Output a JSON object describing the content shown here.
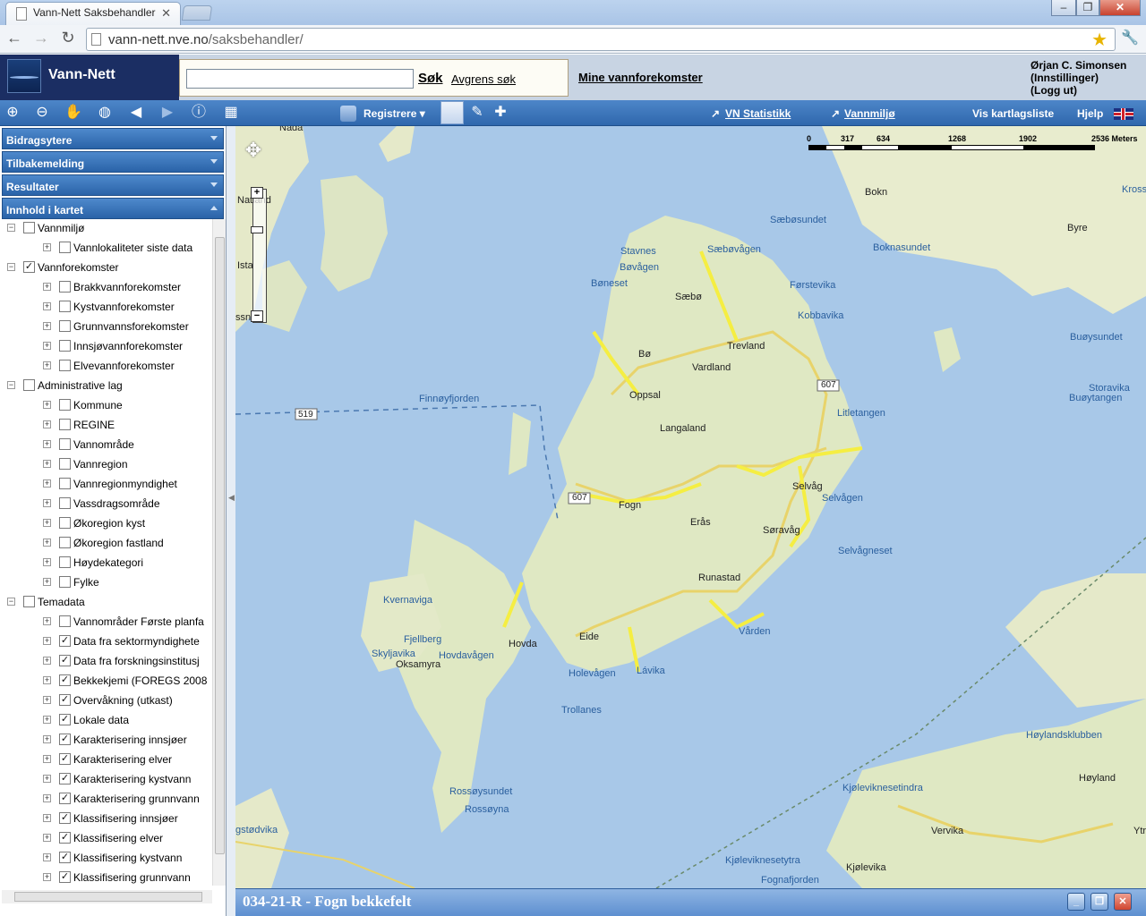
{
  "browser": {
    "tab_title": "Vann-Nett Saksbehandler",
    "url_host": "vann-nett.nve.no",
    "url_path": "/saksbehandler/"
  },
  "header": {
    "app_name": "Vann-Nett",
    "search_value": "",
    "search_button": "Søk",
    "refine_link": "Avgrens søk",
    "my_waterbodies": "Mine vannforekomster",
    "user_name": "Ørjan C. Simonsen",
    "settings_link": "(Innstillinger)",
    "logout_link": "(Logg ut)"
  },
  "toolbar": {
    "register_label": "Registrere",
    "statistics_link": "VN Statistikk",
    "vannmiljo_link": "Vannmiljø",
    "layer_list": "Vis kartlagsliste",
    "help": "Hjelp"
  },
  "sidebar": {
    "panels": [
      "Bidragsytere",
      "Tilbakemelding",
      "Resultater",
      "Innhold i kartet"
    ],
    "tree": [
      {
        "label": "Vannmiljø",
        "level": 0,
        "checked": false,
        "expanded": true
      },
      {
        "label": "Vannlokaliteter siste data",
        "level": 1,
        "checked": false
      },
      {
        "label": "Vannforekomster",
        "level": 0,
        "checked": true,
        "expanded": true
      },
      {
        "label": "Brakkvannforekomster",
        "level": 1,
        "checked": false
      },
      {
        "label": "Kystvannforekomster",
        "level": 1,
        "checked": false
      },
      {
        "label": "Grunnvannsforekomster",
        "level": 1,
        "checked": false
      },
      {
        "label": "Innsjøvannforekomster",
        "level": 1,
        "checked": false
      },
      {
        "label": "Elvevannforekomster",
        "level": 1,
        "checked": false
      },
      {
        "label": "Administrative lag",
        "level": 0,
        "checked": false,
        "expanded": true
      },
      {
        "label": "Kommune",
        "level": 1,
        "checked": false
      },
      {
        "label": "REGINE",
        "level": 1,
        "checked": false
      },
      {
        "label": "Vannområde",
        "level": 1,
        "checked": false
      },
      {
        "label": "Vannregion",
        "level": 1,
        "checked": false
      },
      {
        "label": "Vannregionmyndighet",
        "level": 1,
        "checked": false
      },
      {
        "label": "Vassdragsområde",
        "level": 1,
        "checked": false
      },
      {
        "label": "Økoregion kyst",
        "level": 1,
        "checked": false
      },
      {
        "label": "Økoregion fastland",
        "level": 1,
        "checked": false
      },
      {
        "label": "Høydekategori",
        "level": 1,
        "checked": false
      },
      {
        "label": "Fylke",
        "level": 1,
        "checked": false
      },
      {
        "label": "Temadata",
        "level": 0,
        "checked": false,
        "expanded": true
      },
      {
        "label": "Vannområder Første planfa",
        "level": 1,
        "checked": false
      },
      {
        "label": "Data fra sektormyndighete",
        "level": 1,
        "checked": true
      },
      {
        "label": "Data fra forskningsinstitusj",
        "level": 1,
        "checked": true
      },
      {
        "label": "Bekkekjemi (FOREGS 2008",
        "level": 1,
        "checked": true
      },
      {
        "label": "Overvåkning (utkast)",
        "level": 1,
        "checked": true
      },
      {
        "label": "Lokale data",
        "level": 1,
        "checked": true
      },
      {
        "label": "Karakterisering innsjøer",
        "level": 1,
        "checked": true
      },
      {
        "label": "Karakterisering elver",
        "level": 1,
        "checked": true
      },
      {
        "label": "Karakterisering kystvann",
        "level": 1,
        "checked": true
      },
      {
        "label": "Karakterisering grunnvann",
        "level": 1,
        "checked": true
      },
      {
        "label": "Klassifisering innsjøer",
        "level": 1,
        "checked": true
      },
      {
        "label": "Klassifisering elver",
        "level": 1,
        "checked": true
      },
      {
        "label": "Klassifisering kystvann",
        "level": 1,
        "checked": true
      },
      {
        "label": "Klassifisering grunnvann",
        "level": 1,
        "checked": true
      }
    ]
  },
  "map": {
    "scale_labels": [
      "0",
      "317",
      "634",
      "1268",
      "1902",
      "2536 Meters"
    ],
    "water_labels": [
      "Finnøyfjorden",
      "Sæbøvågen",
      "Bøvågen",
      "Selvågen",
      "Hovdavågen",
      "Holevågen",
      "Rossøysundet",
      "Boknasundet",
      "Buøysundet",
      "Fognafjorden",
      "Sæbøsundet",
      "Kvernaviga",
      "Skyljavika",
      "Kobbavika",
      "Førstevika",
      "Selvågneset",
      "Litletangen",
      "Kjøleviknesetindra",
      "Storavika",
      "Buøytangen",
      "Vården",
      "Lávika",
      "Trollanes",
      "Høylandsklubben",
      "Kjøleviknesetytra",
      "Krossn",
      "Stavnes",
      "Bøneset",
      "Fjellberg",
      "Rossøyna",
      "gstødvika"
    ],
    "place_labels": [
      "Sæbø",
      "Bø",
      "Trevland",
      "Vardland",
      "Oppsal",
      "Langaland",
      "Fogn",
      "Erås",
      "Søravåg",
      "Selvåg",
      "Runastad",
      "Hovda",
      "Eide",
      "Oksamyra",
      "Bokn",
      "Byre",
      "Høyland",
      "Vervika",
      "Kjølevika",
      "Ytra",
      "Nada",
      "Natland",
      "Ista",
      "ssn"
    ],
    "roads": [
      "607",
      "519"
    ]
  },
  "infobar": {
    "title": "034-21-R - Fogn bekkefelt"
  }
}
